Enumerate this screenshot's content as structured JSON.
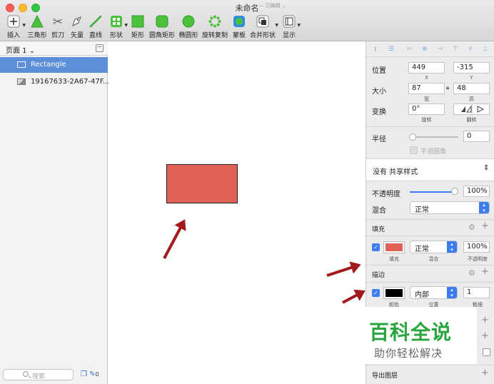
{
  "window": {
    "title": "未命名",
    "title_suffix": "— 已编辑 ⌄"
  },
  "toolbar": {
    "insert": "插入",
    "triangle": "三角形",
    "scissors": "剪刀",
    "vector": "矢量",
    "line": "直线",
    "shape": "形状",
    "rect": "矩形",
    "rounded_rect": "圆角矩形",
    "oval": "椭圆形",
    "rotate_copy": "旋转复制",
    "mask": "蒙板",
    "combine": "合并形状",
    "view": "显示"
  },
  "layers": {
    "page_label": "页面 1 ⌄",
    "items": [
      {
        "name": "Rectangle",
        "selected": true
      },
      {
        "name": "19167633-2A67-47F..."
      }
    ],
    "search_placeholder": "搜索",
    "count": "0"
  },
  "inspector": {
    "position_label": "位置",
    "x_value": "449",
    "y_value": "-315",
    "x_label": "X",
    "y_label": "Y",
    "size_label": "大小",
    "w_value": "87",
    "h_value": "48",
    "w_label": "宽",
    "h_label": "高",
    "transform_label": "变换",
    "rotate_value": "0°",
    "rotate_label": "旋转",
    "flip_label": "翻转",
    "radius_label": "半径",
    "radius_value": "0",
    "smooth_label": "平滑圆角",
    "style_label": "没有 共享样式",
    "opacity_label": "不透明度",
    "opacity_value": "100%",
    "opacity_level": 1.0,
    "blend_label": "混合",
    "blend_value": "正常",
    "fill_section": "填充",
    "fill": {
      "color": "#e06158",
      "color_label": "填充",
      "mode_value": "正常",
      "mode_label": "混合",
      "opacity_value": "100%",
      "opacity_label": "不透明度"
    },
    "border_section": "描边",
    "border": {
      "color": "#000000",
      "color_label": "颜色",
      "position_value": "内部",
      "position_label": "位置",
      "width_value": "1",
      "width_label": "粗细"
    },
    "export_label": "导出图层"
  },
  "watermark": {
    "main": "百科全说",
    "sub": "助你轻松解决"
  },
  "colors": {
    "accent": "#3c7ef2",
    "selection": "#5b8fd9",
    "rect_fill": "#e06158",
    "arrow": "#a11a1e"
  }
}
